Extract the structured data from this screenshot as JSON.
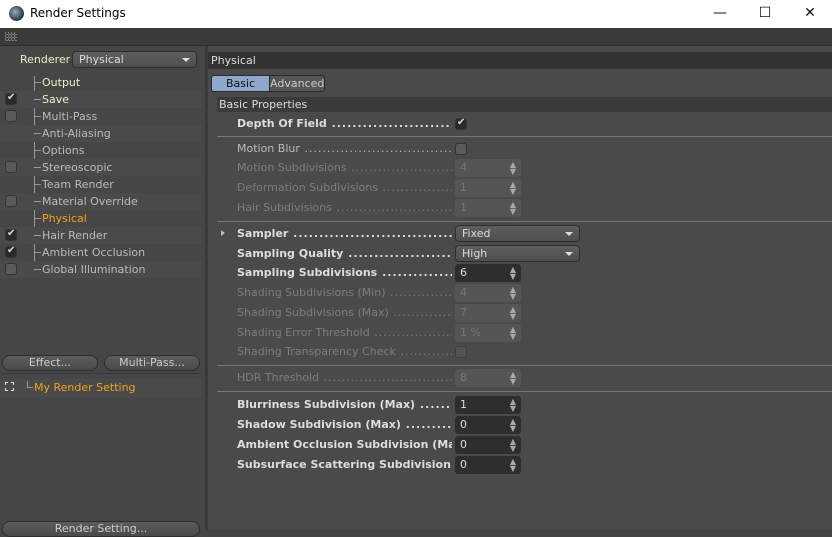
{
  "window": {
    "title": "Render Settings",
    "minimize": "—",
    "maximize": "☐",
    "close": "✕"
  },
  "left": {
    "renderer_label": "Renderer",
    "renderer_value": "Physical",
    "items": [
      {
        "label": "Output",
        "checkbox": null,
        "color": "#f0eec0"
      },
      {
        "label": "Save",
        "checkbox": true,
        "color": "#f0eec0"
      },
      {
        "label": "Multi-Pass",
        "checkbox": false,
        "color": "#bbbbbb"
      },
      {
        "label": "Anti-Aliasing",
        "checkbox": null,
        "color": "#bbbbbb"
      },
      {
        "label": "Options",
        "checkbox": null,
        "color": "#bbbbbb"
      },
      {
        "label": "Stereoscopic",
        "checkbox": false,
        "color": "#bbbbbb"
      },
      {
        "label": "Team Render",
        "checkbox": null,
        "color": "#bbbbbb"
      },
      {
        "label": "Material Override",
        "checkbox": false,
        "color": "#bbbbbb"
      },
      {
        "label": "Physical",
        "checkbox": null,
        "color": "#f0a020"
      },
      {
        "label": "Hair Render",
        "checkbox": true,
        "color": "#bbbbbb"
      },
      {
        "label": "Ambient Occlusion",
        "checkbox": true,
        "color": "#bbbbbb"
      },
      {
        "label": "Global Illumination",
        "checkbox": false,
        "color": "#bbbbbb"
      }
    ],
    "effect_button": "Effect...",
    "multipass_button": "Multi-Pass...",
    "setting_name": "My Render Setting",
    "render_setting_button": "Render Setting..."
  },
  "right": {
    "header": "Physical",
    "tabs": [
      {
        "label": "Basic",
        "active": true
      },
      {
        "label": "Advanced",
        "active": false
      }
    ],
    "section": "Basic Properties",
    "rows": [
      {
        "label": "Depth Of Field",
        "type": "check",
        "value": true,
        "style": "b"
      },
      {
        "sep": true
      },
      {
        "label": "Motion Blur",
        "type": "check",
        "value": false,
        "style": "n"
      },
      {
        "label": "Motion Subdivisions",
        "type": "num",
        "value": "4",
        "style": "d"
      },
      {
        "label": "Deformation Subdivisions",
        "type": "num",
        "value": "1",
        "style": "d"
      },
      {
        "label": "Hair Subdivisions",
        "type": "num",
        "value": "1",
        "style": "d"
      },
      {
        "sep": true
      },
      {
        "label": "Sampler",
        "type": "dd",
        "value": "Fixed",
        "style": "b",
        "expand": true
      },
      {
        "label": "Sampling Quality",
        "type": "dd",
        "value": "High",
        "style": "b"
      },
      {
        "label": "Sampling Subdivisions",
        "type": "num",
        "value": "6",
        "style": "b"
      },
      {
        "label": "Shading Subdivisions (Min)",
        "type": "num",
        "value": "4",
        "style": "d"
      },
      {
        "label": "Shading Subdivisions (Max)",
        "type": "num",
        "value": "7",
        "style": "d"
      },
      {
        "label": "Shading Error Threshold",
        "type": "num",
        "value": "1 %",
        "style": "d"
      },
      {
        "label": "Shading Transparency Check",
        "type": "check",
        "value": false,
        "style": "d"
      },
      {
        "sep": true
      },
      {
        "label": "HDR Threshold",
        "type": "num",
        "value": "8",
        "style": "d"
      },
      {
        "sep": true
      },
      {
        "label": "Blurriness Subdivision (Max)",
        "type": "num",
        "value": "1",
        "style": "b"
      },
      {
        "label": "Shadow Subdivision (Max)",
        "type": "num",
        "value": "0",
        "style": "b"
      },
      {
        "label": "Ambient Occlusion Subdivision (Max)",
        "type": "num",
        "value": "0",
        "style": "b"
      },
      {
        "label": "Subsurface Scattering Subdivision (Max)",
        "type": "num",
        "value": "0",
        "style": "b"
      }
    ]
  }
}
